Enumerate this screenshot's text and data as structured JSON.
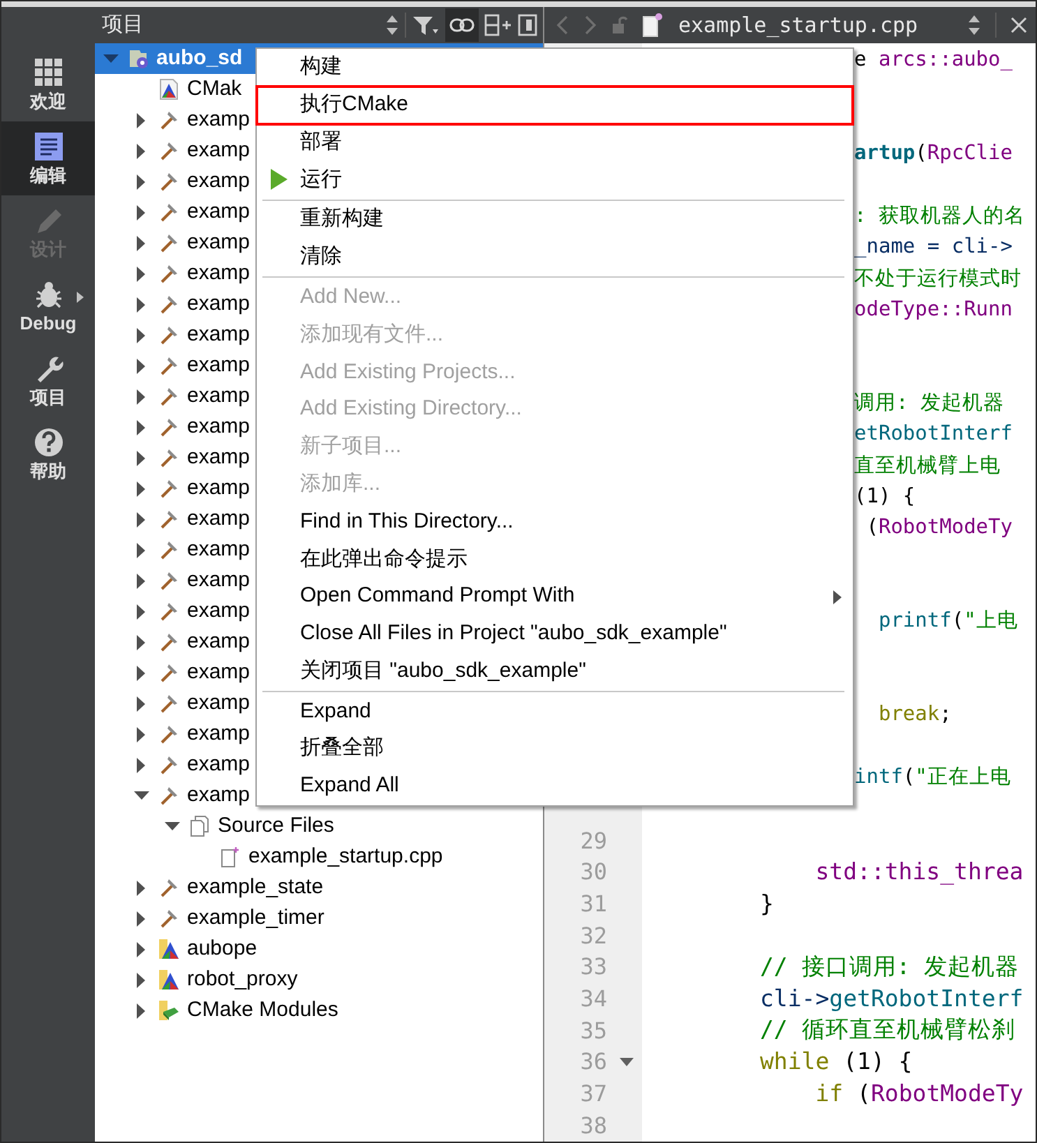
{
  "mode_bar": [
    {
      "label": "欢迎",
      "kind": "grid",
      "selected": false,
      "disabled": false,
      "submenu": false
    },
    {
      "label": "编辑",
      "kind": "edit",
      "selected": true,
      "disabled": false,
      "submenu": false
    },
    {
      "label": "设计",
      "kind": "pencil",
      "selected": false,
      "disabled": true,
      "submenu": false
    },
    {
      "label": "Debug",
      "kind": "bug",
      "selected": false,
      "disabled": false,
      "submenu": true
    },
    {
      "label": "项目",
      "kind": "wrench",
      "selected": false,
      "disabled": false,
      "submenu": false
    },
    {
      "label": "帮助",
      "kind": "help",
      "selected": false,
      "disabled": false,
      "submenu": false
    }
  ],
  "projects_panel": {
    "title": "项目",
    "tree": [
      {
        "label": "aubo_sd",
        "kind": "project",
        "expanded": true,
        "selected": true,
        "children": [
          {
            "label": "CMak",
            "kind": "cmake_file",
            "selected": false
          },
          {
            "label": "examp",
            "kind": "target",
            "expanded": false,
            "selected": false
          },
          {
            "label": "examp",
            "kind": "target",
            "expanded": false,
            "selected": false
          },
          {
            "label": "examp",
            "kind": "target",
            "expanded": false,
            "selected": false
          },
          {
            "label": "examp",
            "kind": "target",
            "expanded": false,
            "selected": false
          },
          {
            "label": "examp",
            "kind": "target",
            "expanded": false,
            "selected": false
          },
          {
            "label": "examp",
            "kind": "target",
            "expanded": false,
            "selected": false
          },
          {
            "label": "examp",
            "kind": "target",
            "expanded": false,
            "selected": false
          },
          {
            "label": "examp",
            "kind": "target",
            "expanded": false,
            "selected": false
          },
          {
            "label": "examp",
            "kind": "target",
            "expanded": false,
            "selected": false
          },
          {
            "label": "examp",
            "kind": "target",
            "expanded": false,
            "selected": false
          },
          {
            "label": "examp",
            "kind": "target",
            "expanded": false,
            "selected": false
          },
          {
            "label": "examp",
            "kind": "target",
            "expanded": false,
            "selected": false
          },
          {
            "label": "examp",
            "kind": "target",
            "expanded": false,
            "selected": false
          },
          {
            "label": "examp",
            "kind": "target",
            "expanded": false,
            "selected": false
          },
          {
            "label": "examp",
            "kind": "target",
            "expanded": false,
            "selected": false
          },
          {
            "label": "examp",
            "kind": "target",
            "expanded": false,
            "selected": false
          },
          {
            "label": "examp",
            "kind": "target",
            "expanded": false,
            "selected": false
          },
          {
            "label": "examp",
            "kind": "target",
            "expanded": false,
            "selected": false
          },
          {
            "label": "examp",
            "kind": "target",
            "expanded": false,
            "selected": false
          },
          {
            "label": "examp",
            "kind": "target",
            "expanded": false,
            "selected": false
          },
          {
            "label": "examp",
            "kind": "target",
            "expanded": false,
            "selected": false
          },
          {
            "label": "examp",
            "kind": "target",
            "expanded": false,
            "selected": false
          },
          {
            "label": "examp",
            "kind": "target",
            "expanded": true,
            "selected": false,
            "children": [
              {
                "label": "Source Files",
                "kind": "sources",
                "expanded": true,
                "selected": false,
                "children": [
                  {
                    "label": "example_startup.cpp",
                    "kind": "cpp_file",
                    "selected": false
                  }
                ]
              }
            ]
          },
          {
            "label": "example_state",
            "kind": "target",
            "expanded": false,
            "selected": false
          },
          {
            "label": "example_timer",
            "kind": "target",
            "expanded": false,
            "selected": false
          },
          {
            "label": "aubope",
            "kind": "cmake_project",
            "expanded": false,
            "selected": false
          },
          {
            "label": "robot_proxy",
            "kind": "cmake_project",
            "expanded": false,
            "selected": false
          },
          {
            "label": "CMake Modules",
            "kind": "modules",
            "expanded": false,
            "selected": false
          }
        ]
      }
    ]
  },
  "editor": {
    "file_name": "example_startup.cpp",
    "lines": [
      {
        "kind": "covered",
        "tokens": [
          {
            "text": "e ",
            "kind": "plain"
          },
          {
            "text": "arcs::aubo_",
            "kind": "type"
          }
        ]
      },
      {
        "kind": "blank"
      },
      {
        "kind": "blank"
      },
      {
        "kind": "covered",
        "tokens": [
          {
            "text": "artup",
            "kind": "func_bold"
          },
          {
            "text": "(",
            "kind": "plain"
          },
          {
            "text": "RpcClie",
            "kind": "type"
          }
        ]
      },
      {
        "kind": "blank"
      },
      {
        "kind": "covered",
        "tokens": [
          {
            "text": ": 获取机器人的名",
            "kind": "comment"
          }
        ]
      },
      {
        "kind": "covered",
        "tokens": [
          {
            "text": "_name = cli->",
            "kind": "var"
          }
        ]
      },
      {
        "kind": "covered",
        "tokens": [
          {
            "text": "不处于运行模式时",
            "kind": "comment"
          }
        ]
      },
      {
        "kind": "covered",
        "tokens": [
          {
            "text": "odeType::Runn",
            "kind": "type"
          }
        ]
      },
      {
        "kind": "blank"
      },
      {
        "kind": "blank"
      },
      {
        "kind": "covered",
        "tokens": [
          {
            "text": "调用: 发起机器",
            "kind": "comment"
          }
        ]
      },
      {
        "kind": "covered",
        "tokens": [
          {
            "text": "etRobotInterf",
            "kind": "func"
          }
        ]
      },
      {
        "kind": "covered",
        "tokens": [
          {
            "text": "直至机械臂上电",
            "kind": "comment"
          }
        ]
      },
      {
        "kind": "covered",
        "tokens": [
          {
            "text": "(1) {",
            "kind": "plain"
          }
        ]
      },
      {
        "kind": "covered",
        "tokens": [
          {
            "text": " (",
            "kind": "plain"
          },
          {
            "text": "RobotModeTy",
            "kind": "type"
          }
        ]
      },
      {
        "kind": "blank"
      },
      {
        "kind": "blank"
      },
      {
        "kind": "covered",
        "tokens": [
          {
            "text": "  printf",
            "kind": "func"
          },
          {
            "text": "(",
            "kind": "plain"
          },
          {
            "text": "\"上电",
            "kind": "string"
          }
        ]
      },
      {
        "kind": "blank"
      },
      {
        "kind": "blank"
      },
      {
        "kind": "covered",
        "tokens": [
          {
            "text": "  break",
            "kind": "keyword"
          },
          {
            "text": ";",
            "kind": "plain"
          }
        ]
      },
      {
        "kind": "blank"
      },
      {
        "kind": "covered",
        "tokens": [
          {
            "text": "intf",
            "kind": "func"
          },
          {
            "text": "(",
            "kind": "plain"
          },
          {
            "text": "\"正在上电",
            "kind": "string"
          }
        ]
      },
      {
        "kind": "blank"
      },
      {
        "kind": "code",
        "number": "29",
        "fold": false
      },
      {
        "kind": "code",
        "number": "30",
        "fold": false,
        "tokens": [
          {
            "text": "            std::this_threa",
            "kind": "type"
          }
        ]
      },
      {
        "kind": "code",
        "number": "31",
        "fold": false,
        "tokens": [
          {
            "text": "        }",
            "kind": "plain"
          }
        ]
      },
      {
        "kind": "code",
        "number": "32",
        "fold": false
      },
      {
        "kind": "code",
        "number": "33",
        "fold": false,
        "tokens": [
          {
            "text": "        // 接口调用: 发起机器",
            "kind": "comment"
          }
        ]
      },
      {
        "kind": "code",
        "number": "34",
        "fold": false,
        "tokens": [
          {
            "text": "        cli->",
            "kind": "var"
          },
          {
            "text": "getRobotInterf",
            "kind": "func"
          }
        ]
      },
      {
        "kind": "code",
        "number": "35",
        "fold": false,
        "tokens": [
          {
            "text": "        // 循环直至机械臂松刹",
            "kind": "comment"
          }
        ]
      },
      {
        "kind": "code",
        "number": "36",
        "fold": true,
        "tokens": [
          {
            "text": "        while",
            "kind": "keyword"
          },
          {
            "text": " (1) {",
            "kind": "plain"
          }
        ]
      },
      {
        "kind": "code",
        "number": "37",
        "fold": false,
        "tokens": [
          {
            "text": "            if",
            "kind": "keyword"
          },
          {
            "text": " (",
            "kind": "plain"
          },
          {
            "text": "RobotModeTy",
            "kind": "type"
          }
        ]
      },
      {
        "kind": "code",
        "number": "38",
        "fold": false
      }
    ]
  },
  "context_menu": {
    "items": [
      {
        "kind": "item",
        "label": "构建",
        "disabled": false,
        "highlighted": false,
        "submenu": false
      },
      {
        "kind": "item",
        "label": "执行CMake",
        "disabled": false,
        "highlighted": true,
        "submenu": false
      },
      {
        "kind": "item",
        "label": "部署",
        "disabled": false,
        "highlighted": false,
        "submenu": false
      },
      {
        "kind": "run",
        "label": "运行",
        "disabled": false,
        "highlighted": false,
        "submenu": false
      },
      {
        "kind": "separator"
      },
      {
        "kind": "item",
        "label": "重新构建",
        "disabled": false,
        "highlighted": false,
        "submenu": false
      },
      {
        "kind": "item",
        "label": "清除",
        "disabled": false,
        "highlighted": false,
        "submenu": false
      },
      {
        "kind": "separator"
      },
      {
        "kind": "item",
        "label": "Add New...",
        "disabled": true,
        "highlighted": false,
        "submenu": false
      },
      {
        "kind": "item",
        "label": "添加现有文件...",
        "disabled": true,
        "highlighted": false,
        "submenu": false
      },
      {
        "kind": "item",
        "label": "Add Existing Projects...",
        "disabled": true,
        "highlighted": false,
        "submenu": false
      },
      {
        "kind": "item",
        "label": "Add Existing Directory...",
        "disabled": true,
        "highlighted": false,
        "submenu": false
      },
      {
        "kind": "item",
        "label": "新子项目...",
        "disabled": true,
        "highlighted": false,
        "submenu": false
      },
      {
        "kind": "item",
        "label": "添加库...",
        "disabled": true,
        "highlighted": false,
        "submenu": false
      },
      {
        "kind": "item",
        "label": "Find in This Directory...",
        "disabled": false,
        "highlighted": false,
        "submenu": false
      },
      {
        "kind": "item",
        "label": "在此弹出命令提示",
        "disabled": false,
        "highlighted": false,
        "submenu": false
      },
      {
        "kind": "item",
        "label": "Open Command Prompt With",
        "disabled": false,
        "highlighted": false,
        "submenu": true
      },
      {
        "kind": "item",
        "label": "Close All Files in Project \"aubo_sdk_example\"",
        "disabled": false,
        "highlighted": false,
        "submenu": false
      },
      {
        "kind": "item",
        "label": "关闭项目 \"aubo_sdk_example\"",
        "disabled": false,
        "highlighted": false,
        "submenu": false
      },
      {
        "kind": "separator"
      },
      {
        "kind": "item",
        "label": "Expand",
        "disabled": false,
        "highlighted": false,
        "submenu": false
      },
      {
        "kind": "item",
        "label": "折叠全部",
        "disabled": false,
        "highlighted": false,
        "submenu": false
      },
      {
        "kind": "item",
        "label": "Expand All",
        "disabled": false,
        "highlighted": false,
        "submenu": false
      }
    ]
  }
}
